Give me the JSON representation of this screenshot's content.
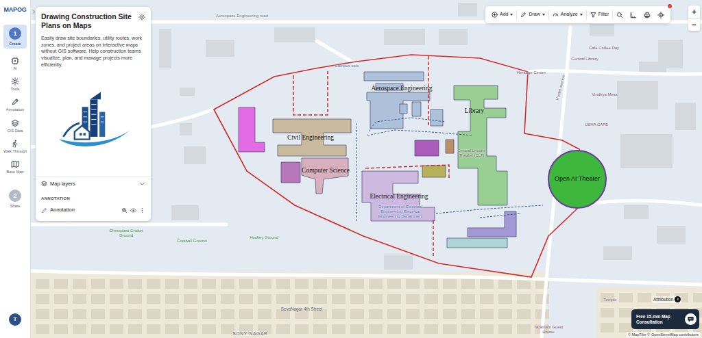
{
  "app": {
    "logo": "MAPOG"
  },
  "rail": {
    "steps": [
      {
        "number": "1",
        "label": "Create",
        "selected": true
      },
      {
        "number": "2",
        "label": "Share",
        "selected": false
      }
    ],
    "tools": [
      {
        "label": "AI"
      },
      {
        "label": "Tools"
      },
      {
        "label": "Annotation"
      },
      {
        "label": "GIS Data"
      },
      {
        "label": "Walk Through"
      },
      {
        "label": "Base Map"
      }
    ],
    "user": "T"
  },
  "panel": {
    "title": "Drawing Construction Site Plans on Maps",
    "description": "Easily draw site boundaries, utility routes, work zones, and project areas on interactive maps without GIS software. Help construction teams visualize, plan, and manage projects more efficiently.",
    "layers": {
      "title": "Map layers",
      "expanded": true,
      "groups": [
        {
          "title": "ANNOTATION",
          "items": [
            {
              "name": "Annotation",
              "visible": true
            }
          ]
        }
      ]
    }
  },
  "toolbar": {
    "buttons": [
      {
        "label": "Add",
        "kind": "menu"
      },
      {
        "label": "Draw",
        "kind": "menu"
      },
      {
        "label": "Analyze",
        "kind": "menu"
      },
      {
        "label": "Filter",
        "kind": "plain"
      }
    ],
    "notification": true
  },
  "zoom": {
    "in": "+",
    "out": "−"
  },
  "map": {
    "labels": [
      {
        "text": "Aerospace Engineering road",
        "kind": "road"
      },
      {
        "text": "Campus cafe",
        "kind": "dept"
      },
      {
        "text": "Heritage Centre",
        "kind": "poi"
      },
      {
        "text": "Central Library",
        "kind": "poi"
      },
      {
        "text": "Cafe Coffee Day",
        "kind": "poi"
      },
      {
        "text": "Hostel avenue",
        "kind": "road"
      },
      {
        "text": "Vindhya Mess",
        "kind": "poi"
      },
      {
        "text": "USHA CAFE",
        "kind": "poi"
      },
      {
        "text": "Central Lecture Theater (CLT)",
        "kind": "poi"
      },
      {
        "text": "Department of Electrical Engineering Electrical Engineering Department",
        "kind": "dept"
      },
      {
        "text": "Chemplast Cricket Ground",
        "kind": "ground"
      },
      {
        "text": "Football Ground",
        "kind": "ground"
      },
      {
        "text": "Hockey Ground",
        "kind": "ground"
      },
      {
        "text": "SevaNagar 4th Street",
        "kind": "street"
      },
      {
        "text": "SONY NAGAR",
        "kind": "district"
      },
      {
        "text": "Temple",
        "kind": "poi"
      },
      {
        "text": "Taramani Guest House",
        "kind": "poi"
      }
    ],
    "buildings": [
      {
        "color": "#e35fe3"
      },
      {
        "label": "Civil Engineering",
        "color": "#c8b597"
      },
      {
        "label": "Computer Science",
        "color": "#d9a9b9"
      },
      {
        "color": "#b46db4"
      },
      {
        "label": "Aerospace Engineering",
        "color": "#a9bdd8"
      },
      {
        "label": "Library",
        "color": "#94cc8c"
      },
      {
        "color": "#a64fb5"
      },
      {
        "color": "#b8875a"
      },
      {
        "color": "#b3ad4b"
      },
      {
        "label": "Electrical Engineering",
        "color": "#cbb3de"
      },
      {
        "color": "#9c90d4"
      },
      {
        "color": "#a9d2d3"
      }
    ],
    "venue": {
      "label": "Open AI Theater",
      "color": "#3db83d"
    }
  },
  "attribution": {
    "label": "Attribution",
    "info": "i",
    "credits": "© MapTiler © OpenStreetMap contributors"
  },
  "consultation": {
    "label": "Free 15-min Map Consultation"
  }
}
